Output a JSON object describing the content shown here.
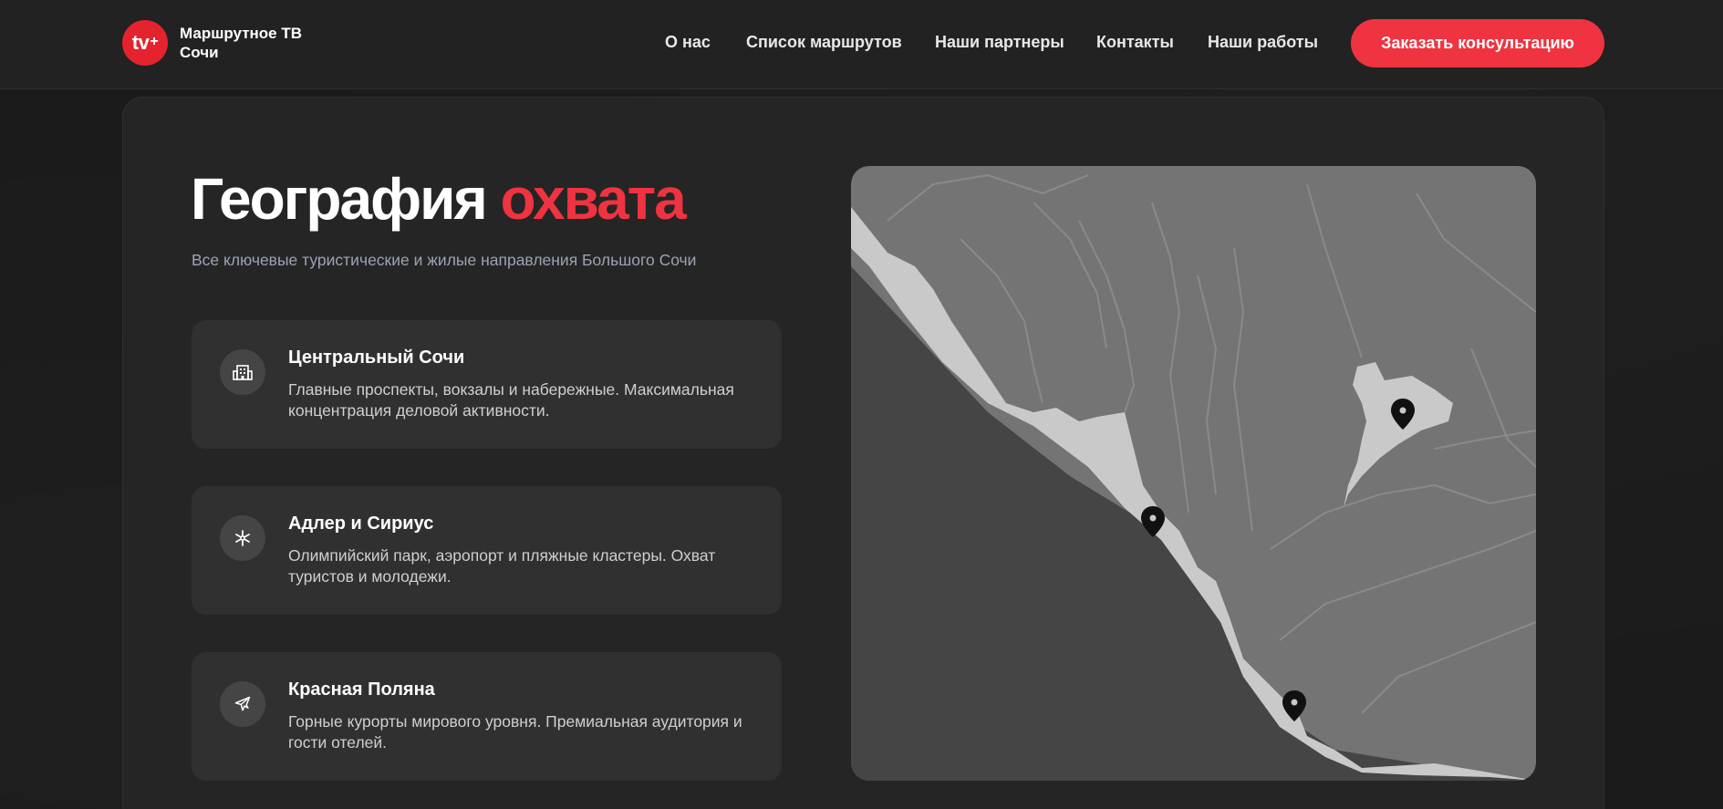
{
  "header": {
    "logo_mark": "tv",
    "logo_plus": "+",
    "brand_name": "Маршрутное ТВ Сочи",
    "nav": [
      "О нас",
      "Список маршрутов",
      "Наши партнеры",
      "Контакты",
      "Наши работы"
    ],
    "cta_label": "Заказать консультацию"
  },
  "section": {
    "title_main": "География",
    "title_accent": "охвата",
    "subtitle": "Все ключевые туристические и жилые направления Большого Сочи"
  },
  "regions": [
    {
      "icon": "building-icon",
      "title": "Центральный Сочи",
      "description": "Главные проспекты, вокзалы и набережные. Максимальная концентрация деловой активности."
    },
    {
      "icon": "snowflake-icon",
      "title": "Адлер и Сириус",
      "description": "Олимпийский парк, аэропорт и пляжные кластеры. Охват туристов и молодежи."
    },
    {
      "icon": "airplane-icon",
      "title": "Красная Поляна",
      "description": "Горные курорты мирового уровня. Премиальная аудитория и гости отелей."
    }
  ],
  "colors": {
    "accent": "#ef3340",
    "background": "#1b1b1b",
    "card": "#252525",
    "tile": "#303030",
    "subtitle": "#9aa3b5"
  }
}
